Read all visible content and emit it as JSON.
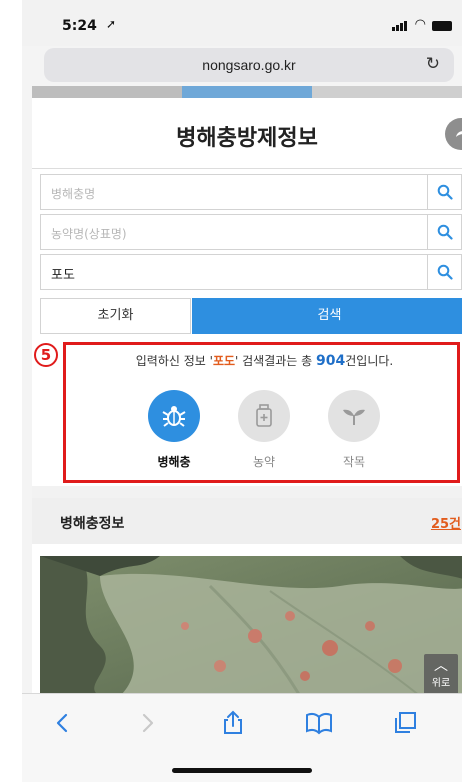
{
  "status_bar": {
    "time": "5:24",
    "location_icon": "location-arrow-icon",
    "signal_icon": "signal-bars-icon",
    "wifi_icon": "wifi-icon",
    "battery_icon": "battery-icon"
  },
  "browser": {
    "url": "nongsaro.go.kr",
    "reload_icon": "reload-icon"
  },
  "page": {
    "title": "병해충방제정보",
    "share_icon": "share-icon"
  },
  "search": {
    "fields": [
      {
        "placeholder": "병해충명",
        "value": ""
      },
      {
        "placeholder": "농약명(상표명)",
        "value": ""
      },
      {
        "placeholder": "",
        "value": "포도"
      }
    ],
    "reset_label": "초기화",
    "search_label": "검색"
  },
  "annotation": {
    "number": "5"
  },
  "result": {
    "prefix": "입력하신 정보 '",
    "keyword": "포도",
    "middle": "' 검색결과는 총 ",
    "count": "904",
    "suffix": "건입니다."
  },
  "categories": [
    {
      "label": "병해충",
      "icon": "bug-icon",
      "active": true
    },
    {
      "label": "농약",
      "icon": "pesticide-bottle-icon",
      "active": false
    },
    {
      "label": "작목",
      "icon": "sprout-icon",
      "active": false
    }
  ],
  "section": {
    "title": "병해충정보",
    "count": "25건"
  },
  "scroll_top": {
    "label": "위로"
  },
  "toolbar": {
    "icons": [
      "back-icon",
      "forward-icon",
      "share-icon",
      "bookmarks-icon",
      "tabs-icon"
    ]
  },
  "colors": {
    "primary": "#2e8fe0",
    "highlight": "#e25c1d",
    "count_blue": "#1f6fc8",
    "annotation_red": "#e01b1b"
  }
}
